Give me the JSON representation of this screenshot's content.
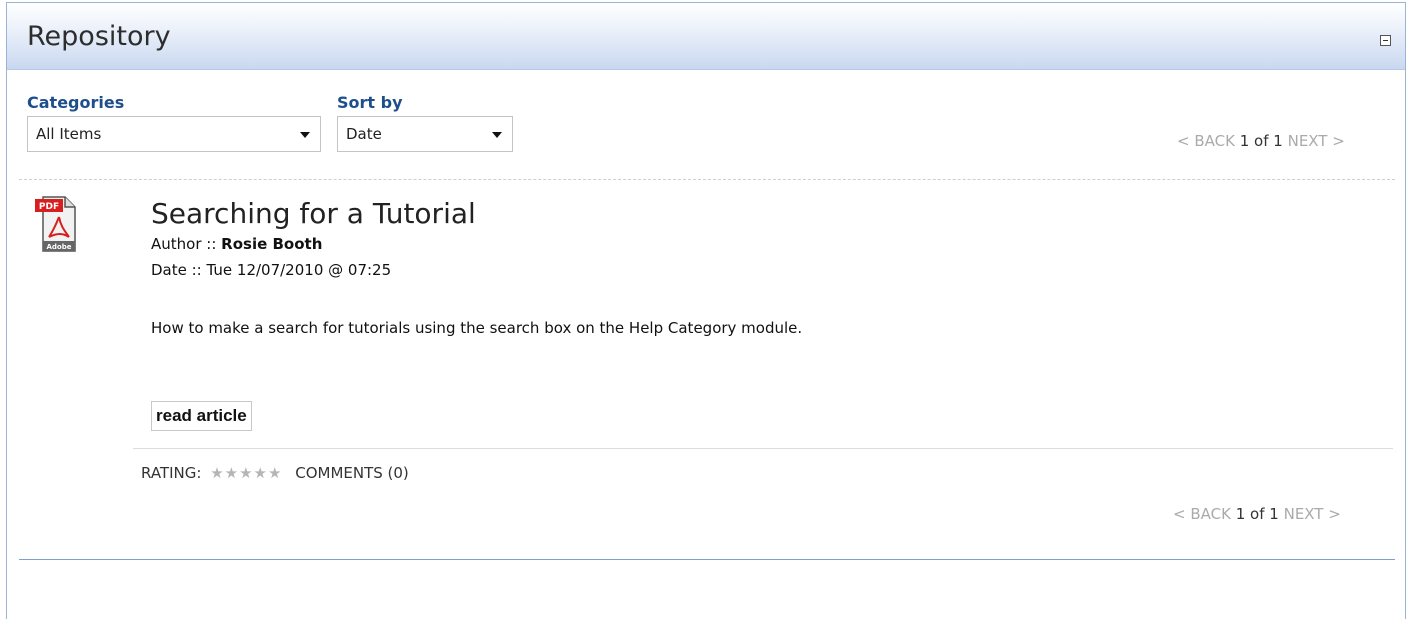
{
  "window": {
    "title": "Repository"
  },
  "filters": {
    "categories_label": "Categories",
    "categories_value": "All Items",
    "sort_label": "Sort by",
    "sort_value": "Date"
  },
  "pager_top": {
    "back": "< BACK",
    "current": "1 of 1",
    "next": "NEXT >"
  },
  "article": {
    "title": "Searching for a Tutorial",
    "author_label": "Author ::",
    "author": "Rosie Booth",
    "date_label": "Date ::",
    "date": "Tue 12/07/2010 @ 07:25",
    "description": "How to make a search for tutorials using the search box on the Help Category module.",
    "read_button": "read article",
    "icon": "pdf-icon",
    "icon_badge": "PDF",
    "icon_text": "Adobe"
  },
  "footer": {
    "rating_label": "RATING:",
    "stars": "★★★★★",
    "rating_value": 0,
    "comments": "COMMENTS (0)"
  },
  "pager_bottom": {
    "back": "< BACK",
    "current": "1 of 1",
    "next": "NEXT >"
  },
  "colors": {
    "accent": "#1e4f8c",
    "header_gradient_end": "#c9d8f0",
    "star_inactive": "#b5b5b5"
  }
}
